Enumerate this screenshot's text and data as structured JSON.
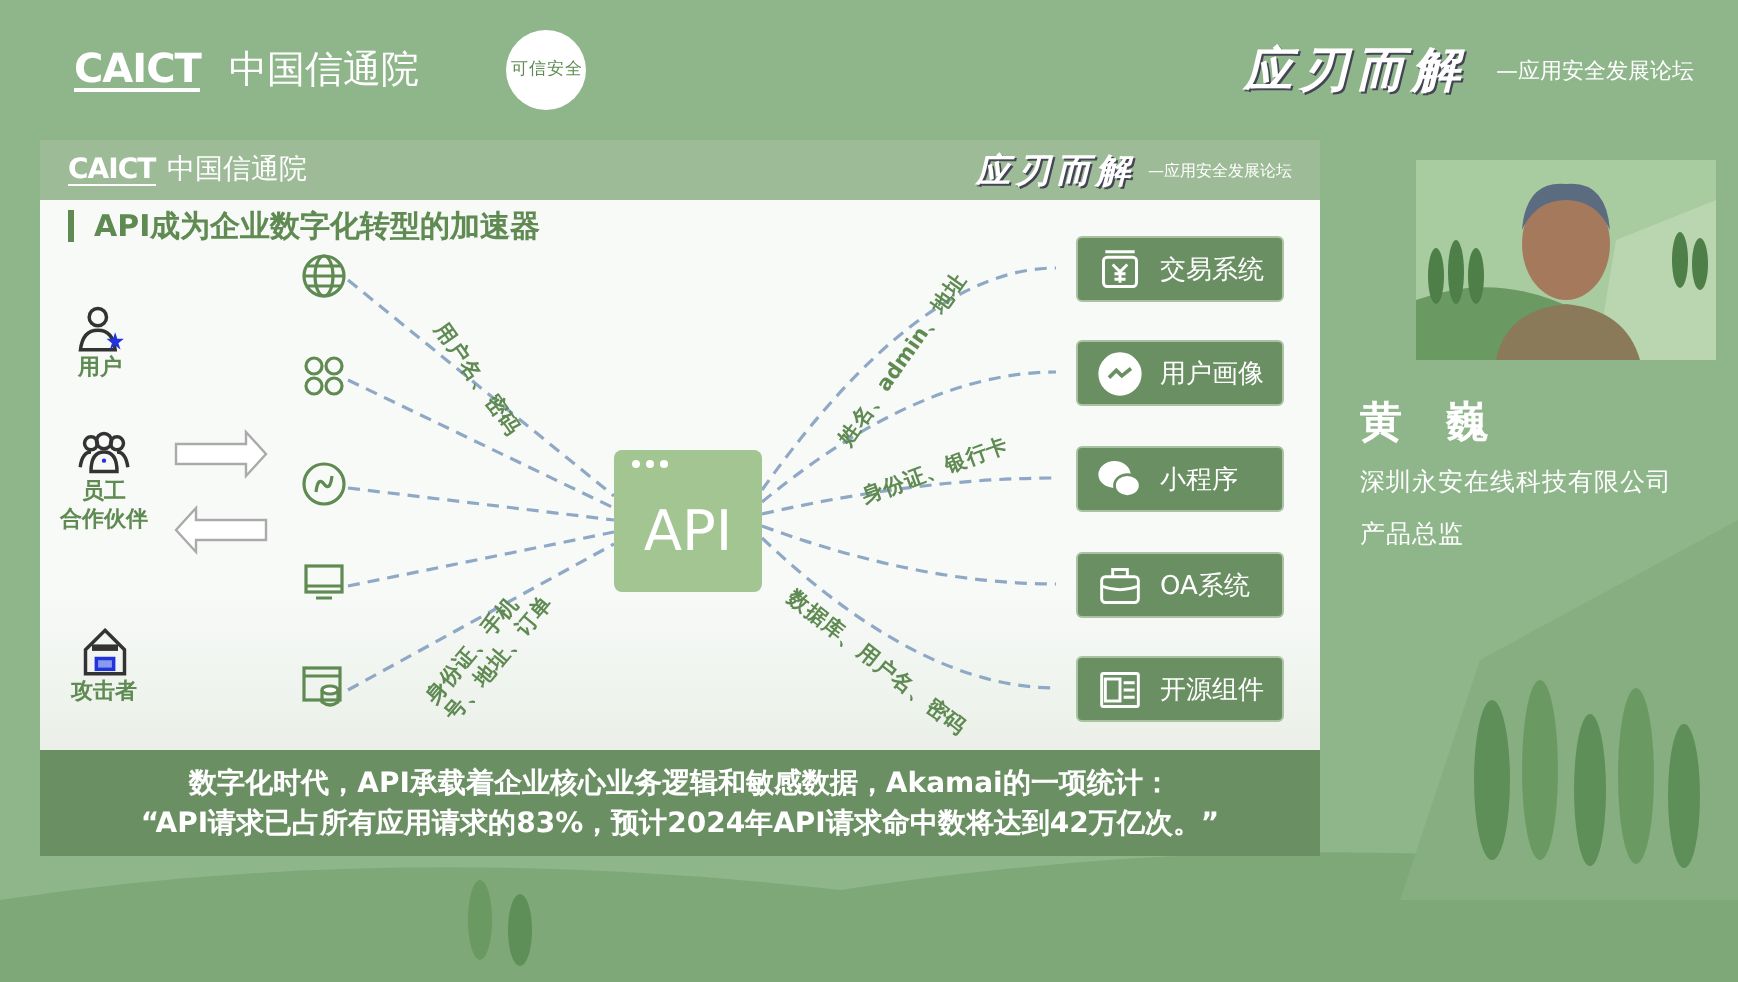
{
  "header": {
    "org_logo": "CAICT",
    "org_name": "中国信通院",
    "badge": "可信安全",
    "title": "应刃而解",
    "subtitle": "—应用安全发展论坛"
  },
  "slide": {
    "org_logo": "CAICT",
    "org_name": "中国信通院",
    "title": "应刃而解",
    "subtitle": "—应用安全发展论坛",
    "heading": "API成为企业数字化转型的加速器",
    "actors": [
      {
        "kind": "user",
        "labels": [
          "用户"
        ]
      },
      {
        "kind": "group",
        "labels": [
          "员工",
          "合作伙伴"
        ]
      },
      {
        "kind": "attacker",
        "labels": [
          "攻击者"
        ]
      }
    ],
    "channels": [
      {
        "kind": "globe"
      },
      {
        "kind": "clover"
      },
      {
        "kind": "link"
      },
      {
        "kind": "monitor"
      },
      {
        "kind": "database"
      }
    ],
    "center": "API",
    "systems": [
      {
        "kind": "yen",
        "label": "交易系统"
      },
      {
        "kind": "trend",
        "label": "用户画像"
      },
      {
        "kind": "chat",
        "label": "小程序"
      },
      {
        "kind": "bag",
        "label": "OA系统"
      },
      {
        "kind": "card",
        "label": "开源组件"
      }
    ],
    "flows": [
      {
        "text": "用户名、密码"
      },
      {
        "text": "身份证、手机号、地址、订单"
      },
      {
        "text": "姓名、admin、地址"
      },
      {
        "text": "身份证、银行卡"
      },
      {
        "text": "数据库、用户名、密码"
      }
    ],
    "caption": [
      "数字化时代，API承载着企业核心业务逻辑和敏感数据，Akamai的一项统计：",
      "“API请求已占所有应用请求的83%，预计2024年API请求命中数将达到42万亿次。”"
    ]
  },
  "speaker": {
    "name": "黄 巍",
    "company": "深圳永安在线科技有限公司",
    "role": "产品总监"
  }
}
